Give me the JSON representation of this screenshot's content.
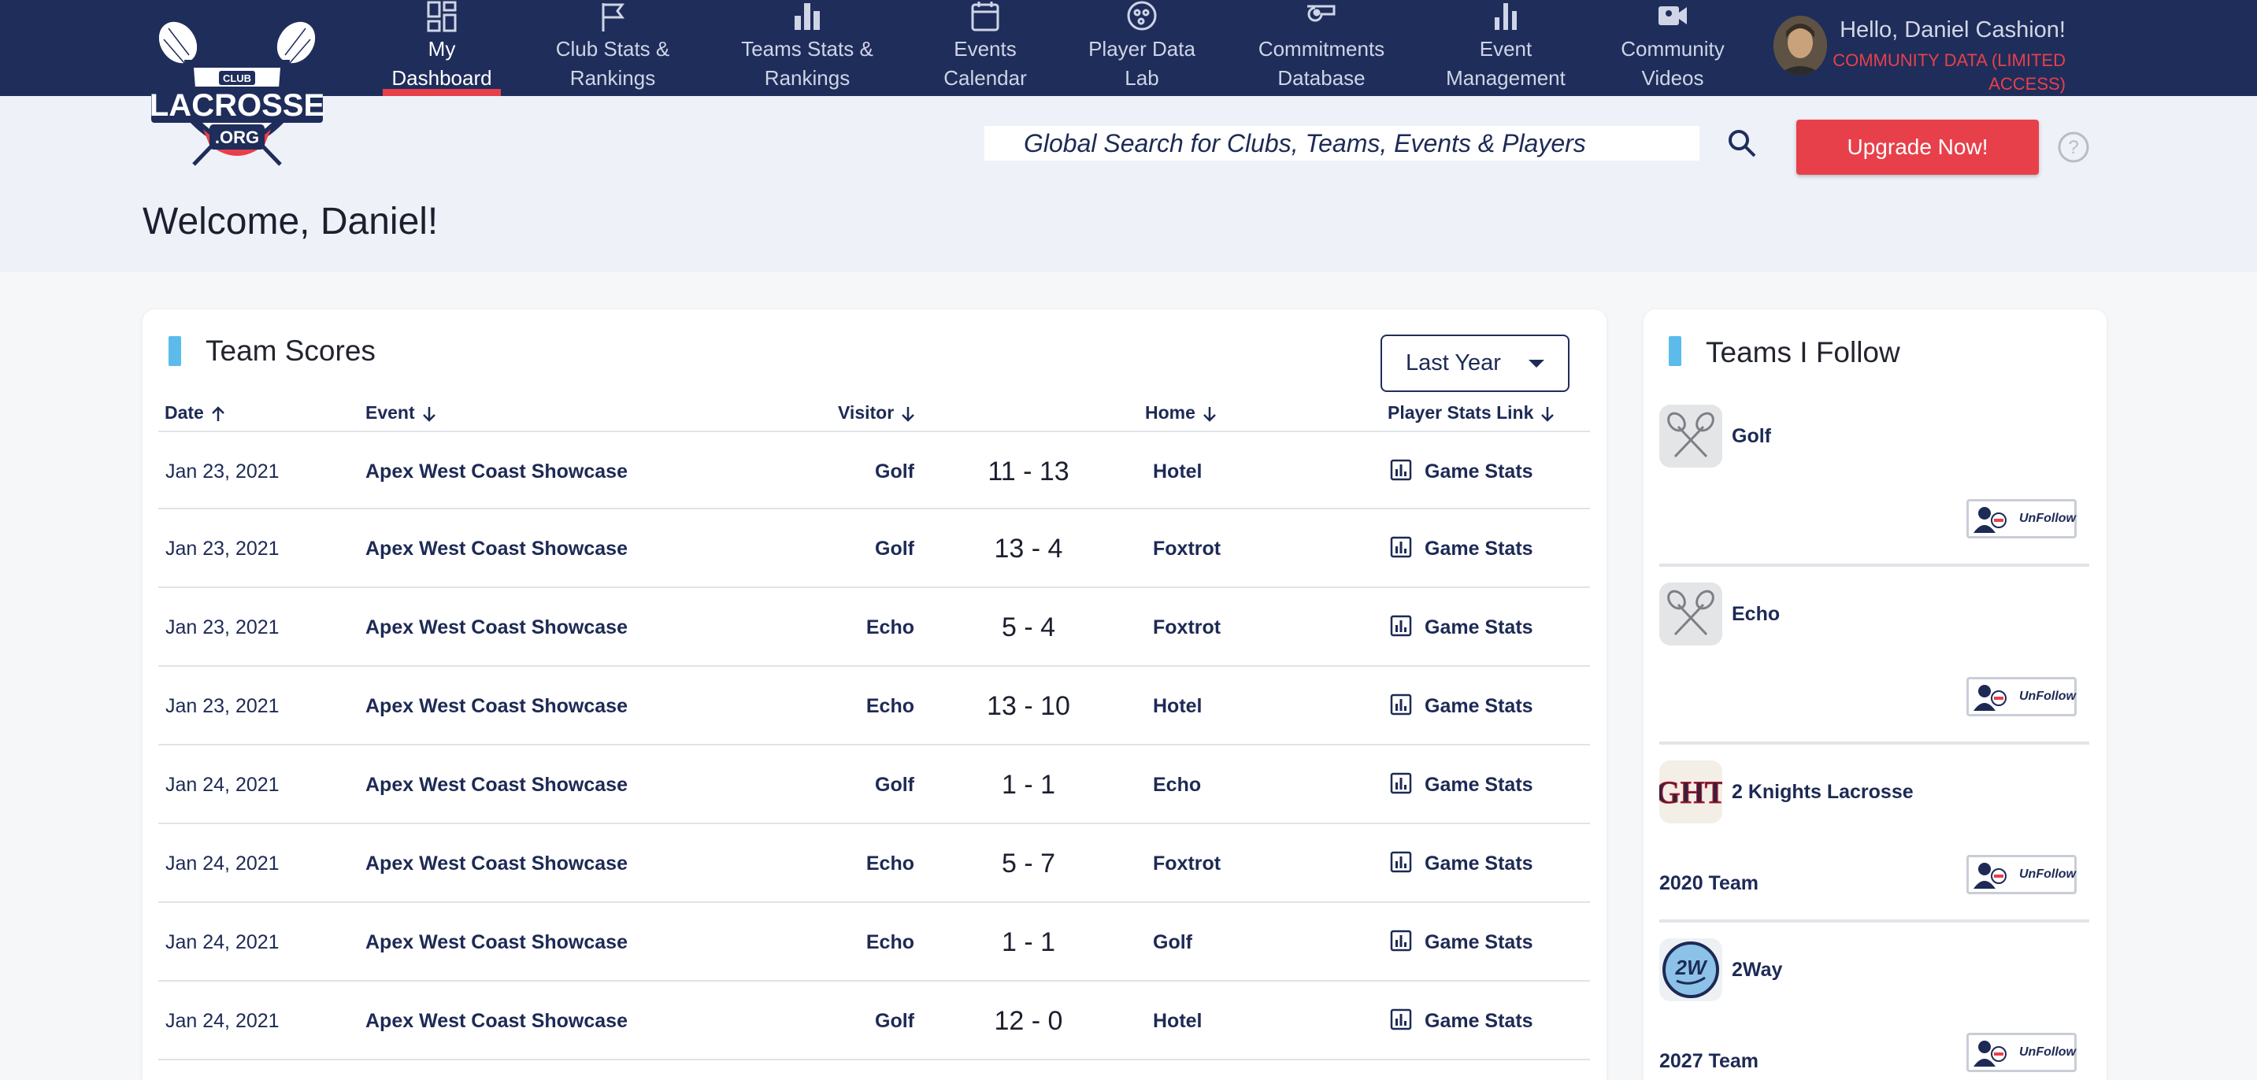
{
  "nav": {
    "items": [
      {
        "label": "My Dashboard",
        "line1": "My",
        "line2": "Dashboard",
        "icon": "dashboard-icon",
        "active": true
      },
      {
        "label": "Club Stats & Rankings",
        "line1": "Club Stats &",
        "line2": "Rankings",
        "icon": "flag-icon",
        "active": false
      },
      {
        "label": "Teams Stats & Rankings",
        "line1": "Teams Stats &",
        "line2": "Rankings",
        "icon": "bar-chart-icon",
        "active": false
      },
      {
        "label": "Events Calendar",
        "line1": "Events",
        "line2": "Calendar",
        "icon": "calendar-icon",
        "active": false
      },
      {
        "label": "Player Data Lab",
        "line1": "Player Data",
        "line2": "Lab",
        "icon": "player-icon",
        "active": false
      },
      {
        "label": "Commitments Database",
        "line1": "Commitments",
        "line2": "Database",
        "icon": "whistle-icon",
        "active": false
      },
      {
        "label": "Event Management",
        "line1": "Event",
        "line2": "Management",
        "icon": "chart-icon",
        "active": false
      },
      {
        "label": "Community Videos",
        "line1": "Community",
        "line2": "Videos",
        "icon": "video-camera-icon",
        "active": false
      }
    ]
  },
  "logo": {
    "top": "CLUB",
    "main": "LACROSSE",
    "bottom": ".ORG"
  },
  "user": {
    "greeting": "Hello, Daniel Cashion!",
    "access": "COMMUNITY DATA (LIMITED ACCESS)"
  },
  "search": {
    "placeholder": "Global Search for Clubs, Teams, Events & Players"
  },
  "upgrade_label": "Upgrade Now!",
  "welcome": "Welcome, Daniel!",
  "scores": {
    "title": "Team Scores",
    "range": "Last Year",
    "headers": {
      "date": "Date",
      "event": "Event",
      "visitor": "Visitor",
      "home": "Home",
      "link": "Player Stats Link"
    },
    "rows": [
      {
        "date": "Jan 23, 2021",
        "event": "Apex West Coast Showcase",
        "visitor": "Golf",
        "score": "11 - 13",
        "home": "Hotel",
        "link": "Game Stats"
      },
      {
        "date": "Jan 23, 2021",
        "event": "Apex West Coast Showcase",
        "visitor": "Golf",
        "score": "13 - 4",
        "home": "Foxtrot",
        "link": "Game Stats"
      },
      {
        "date": "Jan 23, 2021",
        "event": "Apex West Coast Showcase",
        "visitor": "Echo",
        "score": "5 - 4",
        "home": "Foxtrot",
        "link": "Game Stats"
      },
      {
        "date": "Jan 23, 2021",
        "event": "Apex West Coast Showcase",
        "visitor": "Echo",
        "score": "13 - 10",
        "home": "Hotel",
        "link": "Game Stats"
      },
      {
        "date": "Jan 24, 2021",
        "event": "Apex West Coast Showcase",
        "visitor": "Golf",
        "score": "1 - 1",
        "home": "Echo",
        "link": "Game Stats"
      },
      {
        "date": "Jan 24, 2021",
        "event": "Apex West Coast Showcase",
        "visitor": "Echo",
        "score": "5 - 7",
        "home": "Foxtrot",
        "link": "Game Stats"
      },
      {
        "date": "Jan 24, 2021",
        "event": "Apex West Coast Showcase",
        "visitor": "Echo",
        "score": "1 - 1",
        "home": "Golf",
        "link": "Game Stats"
      },
      {
        "date": "Jan 24, 2021",
        "event": "Apex West Coast Showcase",
        "visitor": "Golf",
        "score": "12 - 0",
        "home": "Hotel",
        "link": "Game Stats"
      }
    ]
  },
  "follow": {
    "title": "Teams I Follow",
    "unfollow_label": "UnFollow",
    "teams": [
      {
        "name": "Golf",
        "sub": "",
        "logo": "lacrosse-sticks-icon"
      },
      {
        "name": "Echo",
        "sub": "",
        "logo": "lacrosse-sticks-icon"
      },
      {
        "name": "2 Knights Lacrosse",
        "sub": "2020 Team",
        "logo": "GHT"
      },
      {
        "name": "2Way",
        "sub": "2027 Team",
        "logo": "2W"
      }
    ]
  },
  "colors": {
    "nav_bg": "#1f2d5b",
    "accent_red": "#e8404a",
    "accent_blue": "#5bbcec",
    "hero_bg": "#eef1f8",
    "text_navy": "#1d2a55"
  }
}
